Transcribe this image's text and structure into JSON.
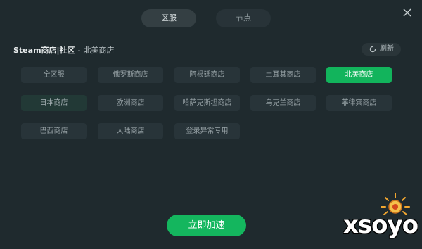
{
  "tabs": {
    "region": "区服",
    "node": "节点"
  },
  "header": {
    "title": "Steam商店|社区",
    "separator": "-",
    "subtitle": "北美商店",
    "refresh_label": "刷新"
  },
  "regions": [
    {
      "label": "全区服",
      "state": "normal"
    },
    {
      "label": "俄罗斯商店",
      "state": "normal"
    },
    {
      "label": "阿根廷商店",
      "state": "normal"
    },
    {
      "label": "土耳其商店",
      "state": "normal"
    },
    {
      "label": "北美商店",
      "state": "selected"
    },
    {
      "label": "日本商店",
      "state": "highlight"
    },
    {
      "label": "欧洲商店",
      "state": "normal"
    },
    {
      "label": "哈萨克斯坦商店",
      "state": "normal"
    },
    {
      "label": "乌克兰商店",
      "state": "normal"
    },
    {
      "label": "菲律宾商店",
      "state": "normal"
    },
    {
      "label": "巴西商店",
      "state": "normal"
    },
    {
      "label": "大陆商店",
      "state": "normal"
    },
    {
      "label": "登录异常专用",
      "state": "normal"
    }
  ],
  "actions": {
    "accelerate_label": "立即加速"
  },
  "watermark": {
    "text": "xsoyo"
  },
  "colors": {
    "background": "#1f2a2e",
    "accent": "#14b65e",
    "button": "#283439"
  },
  "icons": {
    "close": "close-icon",
    "refresh": "refresh-icon",
    "watermark_logo": "sun-logo-icon"
  }
}
